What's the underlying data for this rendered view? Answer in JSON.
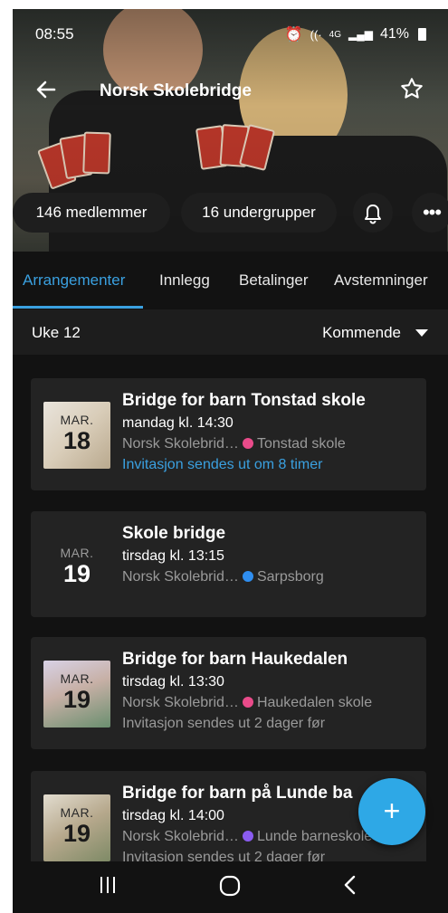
{
  "status": {
    "time": "08:55",
    "network": "4G",
    "battery": "41%"
  },
  "header": {
    "title": "Norsk Skolebridge",
    "back_icon": "arrow-left-icon",
    "favorite_icon": "star-outline-icon"
  },
  "chips": {
    "members": "146 medlemmer",
    "subgroups": "16 undergrupper"
  },
  "tabs": [
    {
      "label": "Arrangementer",
      "active": true
    },
    {
      "label": "Innlegg"
    },
    {
      "label": "Betalinger"
    },
    {
      "label": "Avstemninger"
    }
  ],
  "week_bar": {
    "week": "Uke 12",
    "filter": "Kommende"
  },
  "events": [
    {
      "month": "MAR.",
      "day": "18",
      "name": "Bridge for barn Tonstad skole",
      "when": "mandag kl. 14:30",
      "organizer": "Norsk Skolebrid…",
      "location": "Tonstad skole",
      "dot_color": "#e94b8a",
      "note": "Invitasjon sendes ut om 8 timer",
      "note_color": "#3aa0e0"
    },
    {
      "month": "MAR.",
      "day": "19",
      "name": "Skole bridge",
      "when": "tirsdag kl. 13:15",
      "organizer": "Norsk Skolebrid…",
      "location": "Sarpsborg",
      "dot_color": "#2f8ef0",
      "note": ""
    },
    {
      "month": "MAR.",
      "day": "19",
      "name": "Bridge for barn Haukedalen",
      "when": "tirsdag kl. 13:30",
      "organizer": "Norsk Skolebrid…",
      "location": "Haukedalen skole",
      "dot_color": "#e94b8a",
      "note": "Invitasjon sendes ut 2 dager før"
    },
    {
      "month": "MAR.",
      "day": "19",
      "name": "Bridge for barn på Lunde ba",
      "when": "tirsdag kl. 14:00",
      "organizer": "Norsk Skolebrid…",
      "location": "Lunde barneskole",
      "dot_color": "#8a5cf0",
      "note": "Invitasjon sendes ut 2 dager før"
    }
  ],
  "fab": {
    "label": "+"
  },
  "colors": {
    "accent": "#3aa0e0",
    "background": "#121212",
    "card": "#232323"
  }
}
